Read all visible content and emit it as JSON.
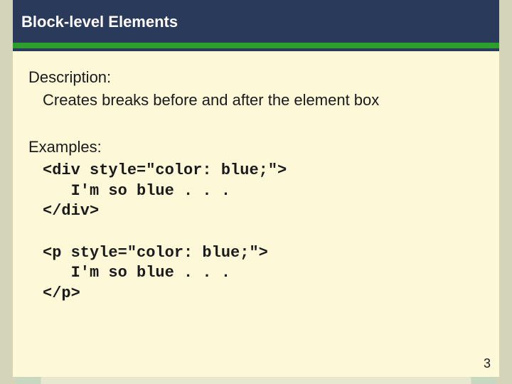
{
  "header": {
    "title": "Block-level Elements"
  },
  "body": {
    "description_label": "Description:",
    "description_text": "Creates breaks before and after the element box",
    "examples_label": "Examples:",
    "code1": "<div style=\"color: blue;\">\n   I'm so blue . . .\n</div>",
    "code2": "<p style=\"color: blue;\">\n   I'm so blue . . .\n</p>"
  },
  "page_number": "3"
}
